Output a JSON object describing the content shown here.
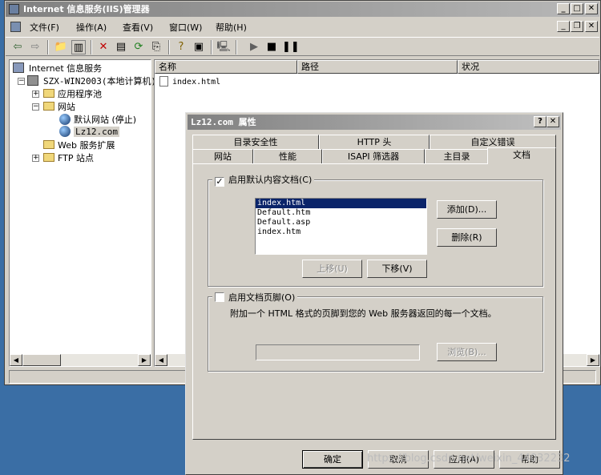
{
  "main_window": {
    "title": "Internet 信息服务(IIS)管理器",
    "menu": [
      "文件(F)",
      "操作(A)",
      "查看(V)",
      "窗口(W)",
      "帮助(H)"
    ],
    "tree": {
      "root": "Internet 信息服务",
      "server": "SZX-WIN2003(本地计算机)",
      "app_pools": "应用程序池",
      "websites": "网站",
      "default_site": "默认网站 (停止)",
      "selected_site": "Lz12.com",
      "web_ext": "Web 服务扩展",
      "ftp": "FTP 站点"
    },
    "list_headers": {
      "name": "名称",
      "path": "路径",
      "status": "状况"
    },
    "list_items": [
      {
        "name": "index.html"
      }
    ]
  },
  "dialog": {
    "title": "Lz12.com 属性",
    "tabs_back": [
      "目录安全性",
      "HTTP 头",
      "自定义错误"
    ],
    "tabs_front": [
      "网站",
      "性能",
      "ISAPI 筛选器",
      "主目录",
      "文档"
    ],
    "active_tab": "文档",
    "default_docs": {
      "checkbox_label": "启用默认内容文档(C)",
      "checked": true,
      "items": [
        "index.html",
        "Default.htm",
        "Default.asp",
        "index.htm"
      ],
      "selected_index": 0,
      "add_label": "添加(D)...",
      "remove_label": "删除(R)",
      "move_up_label": "上移(U)",
      "move_down_label": "下移(V)"
    },
    "footer": {
      "checkbox_label": "启用文档页脚(O)",
      "checked": false,
      "desc": "附加一个 HTML 格式的页脚到您的 Web 服务器返回的每一个文档。",
      "path_value": "",
      "browse_label": "浏览(B)..."
    },
    "buttons": {
      "ok": "确定",
      "cancel": "取消",
      "apply": "应用(A)",
      "help": "帮助"
    }
  },
  "watermark": "https://blog.csdn.net/weixin_44032232"
}
